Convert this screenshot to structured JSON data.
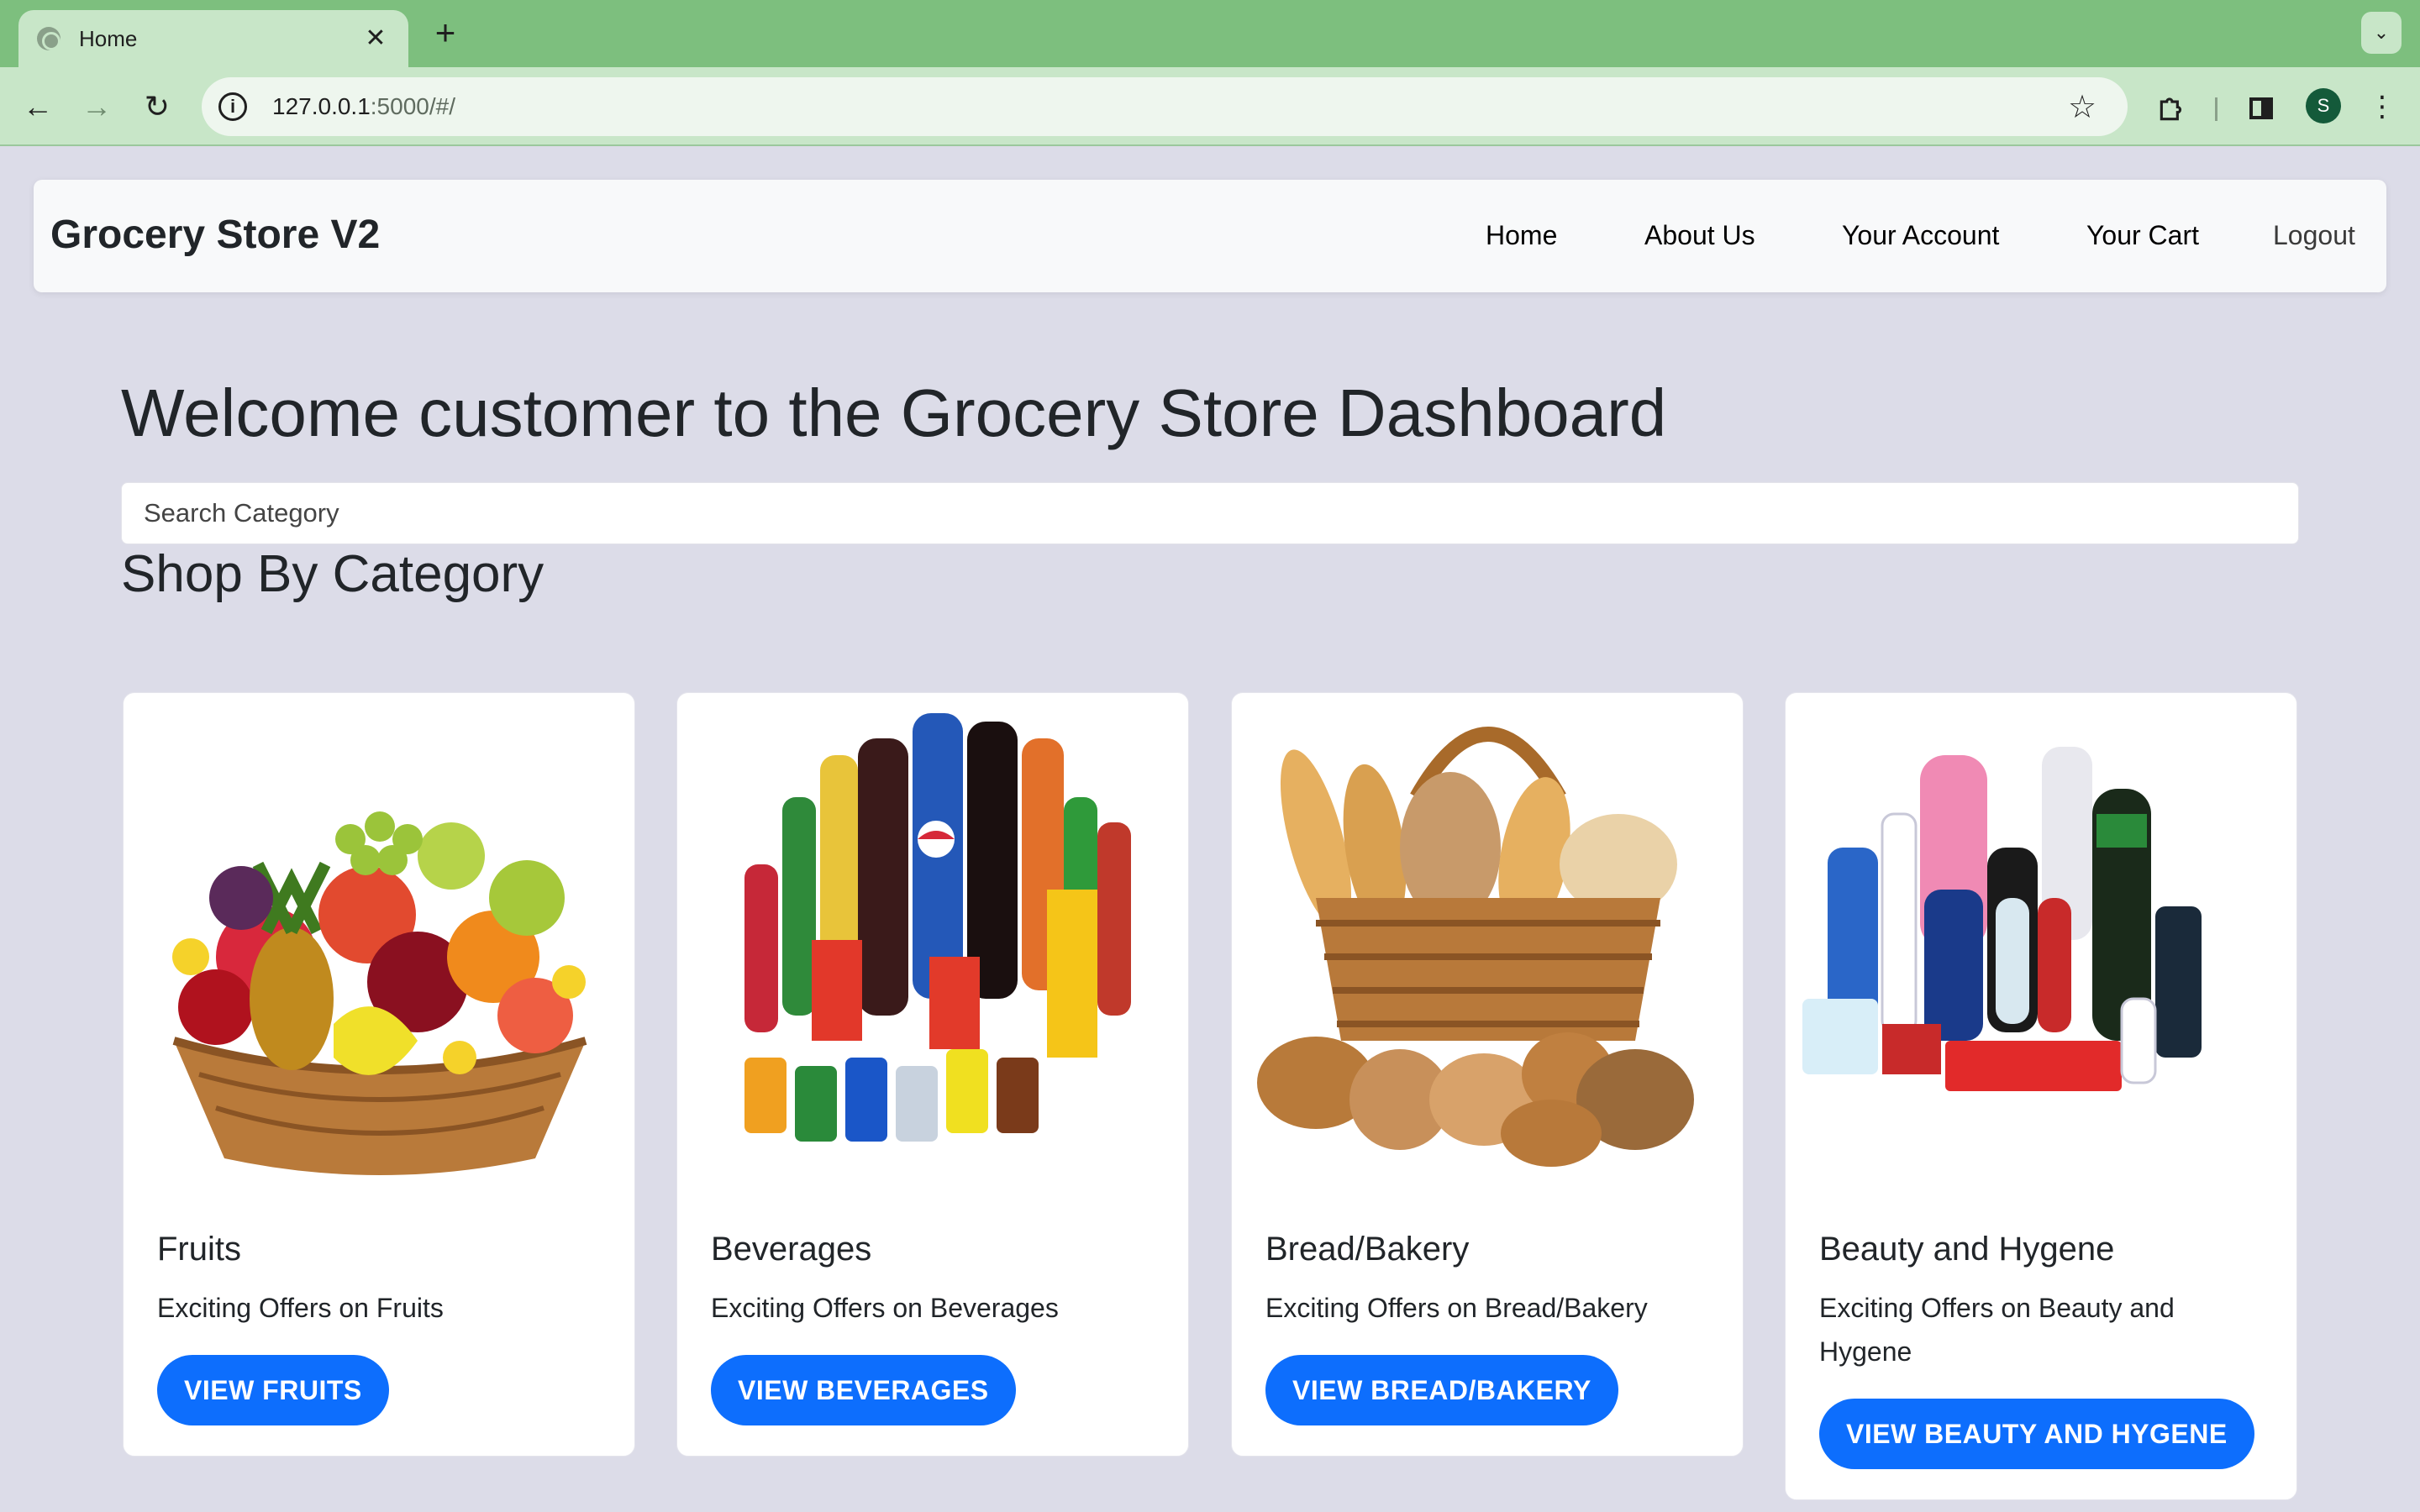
{
  "browser": {
    "tab_title": "Home",
    "tab_close": "✕",
    "new_tab": "+",
    "url_host": "127.0.0.1",
    "url_path": ":5000/#/",
    "profile_initial": "S"
  },
  "navbar": {
    "brand": "Grocery Store V2",
    "links": [
      "Home",
      "About Us",
      "Your Account",
      "Your Cart",
      "Logout"
    ]
  },
  "main": {
    "welcome": "Welcome customer to the Grocery Store Dashboard",
    "search_placeholder": "Search Category",
    "section_title": "Shop By Category"
  },
  "categories": [
    {
      "title": "Fruits",
      "text": "Exciting Offers on Fruits",
      "button": "VIEW FRUITS"
    },
    {
      "title": "Beverages",
      "text": "Exciting Offers on Beverages",
      "button": "VIEW BEVERAGES"
    },
    {
      "title": "Bread/Bakery",
      "text": "Exciting Offers on Bread/Bakery",
      "button": "VIEW BREAD/BAKERY"
    },
    {
      "title": "Beauty and Hygene",
      "text": "Exciting Offers on Beauty and Hygene",
      "button": "VIEW BEAUTY AND HYGENE"
    }
  ],
  "colors": {
    "accent": "#0d6efd",
    "page_bg": "#dcdce8",
    "browser_frame": "#7dbf7e"
  }
}
